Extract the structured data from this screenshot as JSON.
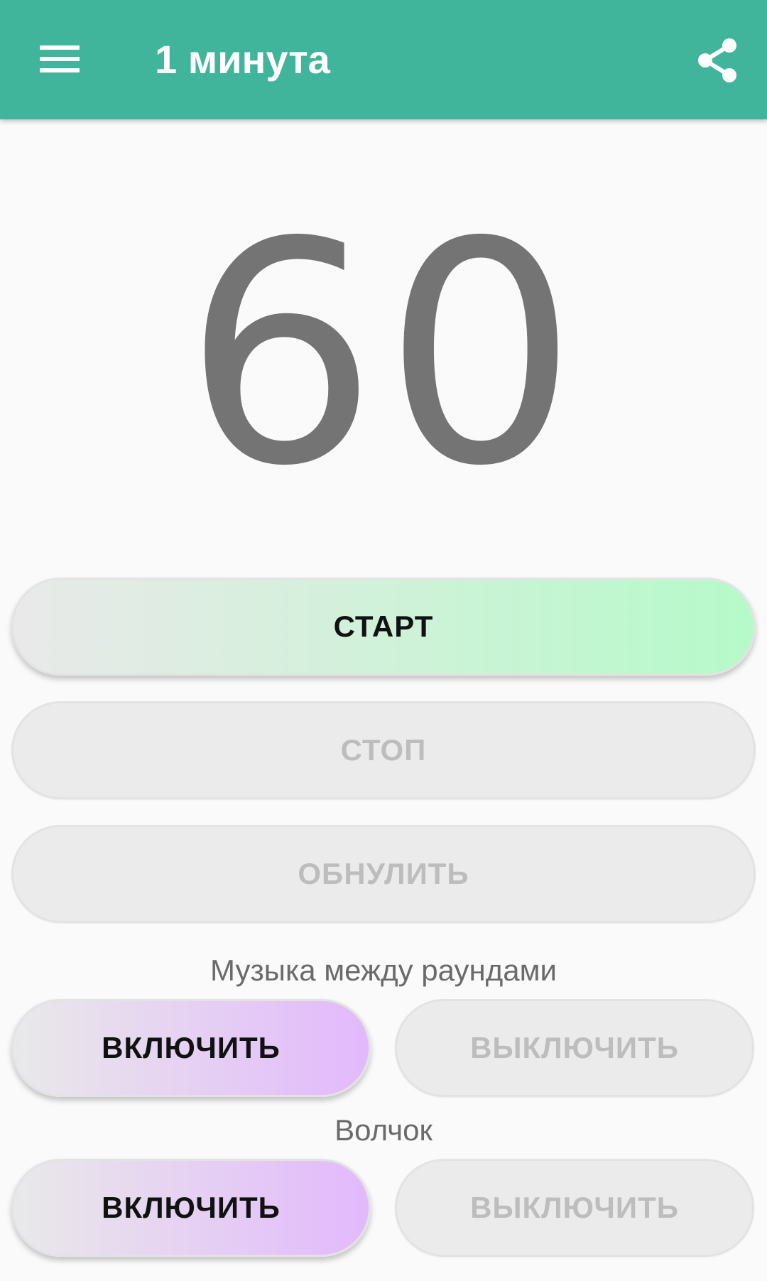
{
  "appbar": {
    "title": "1 минута",
    "background_color": "#41b59b",
    "menu_icon": "hamburger-menu-icon",
    "share_icon": "share-icon"
  },
  "timer": {
    "value": "60"
  },
  "controls": {
    "start_label": "СТАРТ",
    "stop_label": "СТОП",
    "reset_label": "ОБНУЛИТЬ"
  },
  "music": {
    "label": "Музыка между раундами",
    "enable_label": "ВКЛЮЧИТЬ",
    "disable_label": "ВЫКЛЮЧИТЬ"
  },
  "spinner": {
    "label": "Волчок",
    "enable_label": "ВКЛЮЧИТЬ",
    "disable_label": "ВЫКЛЮЧИТЬ"
  },
  "colors": {
    "start_gradient_end": "#b6fac9",
    "enable_gradient_end": "#e2b9fc",
    "disabled_text": "#bdbdbd",
    "timer_text": "#747474"
  }
}
